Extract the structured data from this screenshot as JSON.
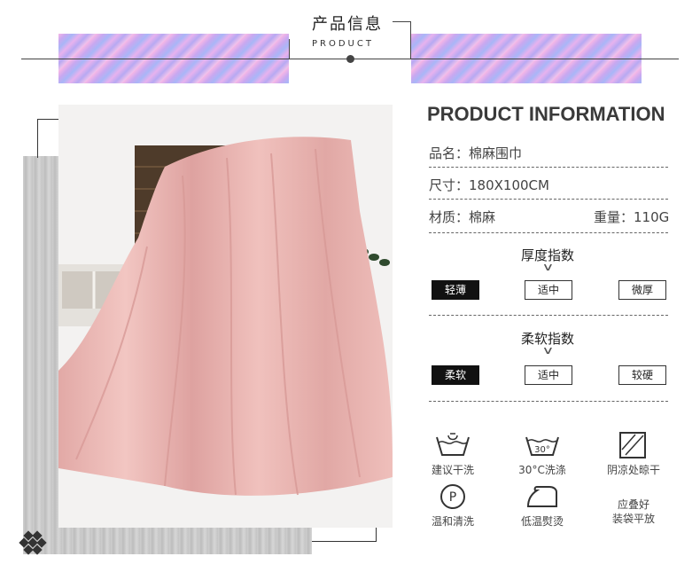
{
  "header": {
    "title_cn": "产品信息",
    "title_en": "PRODUCT"
  },
  "info": {
    "heading": "PRODUCT INFORMATION",
    "name": "品名：棉麻围巾",
    "size": "尺寸：180X100CM",
    "material": "材质：棉麻",
    "weight": "重量：110G"
  },
  "thickness": {
    "title": "厚度指数",
    "options": [
      "轻薄",
      "适中",
      "微厚"
    ],
    "selected_index": 0
  },
  "softness": {
    "title": "柔软指数",
    "options": [
      "柔软",
      "适中",
      "较硬"
    ],
    "selected_index": 0
  },
  "care": {
    "items": [
      {
        "icon": "handwash-icon",
        "label": "建议干洗"
      },
      {
        "icon": "wash-30-icon",
        "label": "30°C洗涤",
        "icon_text": "30°"
      },
      {
        "icon": "shade-dry-icon",
        "label": "阴凉处晾干"
      },
      {
        "icon": "professional-clean-icon",
        "label": "温和清洗",
        "icon_text": "P"
      },
      {
        "icon": "low-iron-icon",
        "label": "低温熨烫"
      },
      {
        "icon": "fold-flat-text",
        "label": "应叠好\n装袋平放"
      }
    ]
  },
  "colors": {
    "scarf": "#e9b7b3",
    "basket": "#4e3b2a",
    "selected_option": "#111111"
  }
}
